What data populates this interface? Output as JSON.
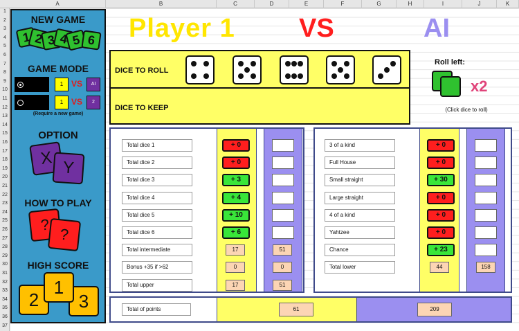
{
  "spreadsheet": {
    "columns": [
      "A",
      "B",
      "C",
      "D",
      "E",
      "F",
      "G",
      "H",
      "I",
      "J",
      "K"
    ],
    "rows": [
      "1",
      "2",
      "3",
      "4",
      "5",
      "6",
      "7",
      "8",
      "9",
      "10",
      "11",
      "12",
      "13",
      "14",
      "15",
      "16",
      "17",
      "18",
      "19",
      "20",
      "21",
      "22",
      "23",
      "24",
      "25",
      "26",
      "27",
      "28",
      "29",
      "30",
      "31",
      "32",
      "33",
      "34",
      "35",
      "36",
      "37"
    ]
  },
  "sidebar": {
    "new_game": {
      "title": "NEW GAME",
      "dice": [
        "1",
        "2",
        "3",
        "4",
        "5",
        "6"
      ]
    },
    "game_mode": {
      "title": "GAME MODE",
      "mode1": {
        "left": "1",
        "vs": "VS",
        "right": "AI"
      },
      "mode2": {
        "left": "1",
        "vs": "VS",
        "right": "2"
      },
      "note": "(Require a new game)"
    },
    "option": {
      "title": "OPTION",
      "dice": [
        "X",
        "Y"
      ]
    },
    "how_to_play": {
      "title": "HOW TO PLAY",
      "dice": [
        "?",
        "?"
      ]
    },
    "high_score": {
      "title": "HIGH SCORE",
      "dice": [
        "2",
        "1",
        "3"
      ]
    }
  },
  "header": {
    "player1": "Player 1",
    "vs": "VS",
    "player2": "AI"
  },
  "dice_panel": {
    "to_roll_label": "DICE TO ROLL",
    "to_keep_label": "DICE TO KEEP",
    "dice_to_roll": [
      4,
      5,
      6,
      5,
      3
    ]
  },
  "roll": {
    "label": "Roll left:",
    "count": "x2",
    "hint": "(Click dice to roll)"
  },
  "upper": {
    "rows": [
      {
        "label": "Total dice 1",
        "value": "+ 0",
        "color": "red"
      },
      {
        "label": "Total dice 2",
        "value": "+ 0",
        "color": "red"
      },
      {
        "label": "Total dice 3",
        "value": "+ 3",
        "color": "green"
      },
      {
        "label": "Total dice 4",
        "value": "+ 4",
        "color": "green"
      },
      {
        "label": "Total dice 5",
        "value": "+ 10",
        "color": "green"
      },
      {
        "label": "Total dice 6",
        "value": "+ 6",
        "color": "green"
      }
    ],
    "intermediate": {
      "label": "Total intermediate",
      "p1": "17",
      "ai": "51"
    },
    "bonus": {
      "label": "Bonus +35 if >62",
      "p1": "0",
      "ai": "0"
    },
    "total": {
      "label": "Total upper",
      "p1": "17",
      "ai": "51"
    }
  },
  "lower": {
    "rows": [
      {
        "label": "3 of a kind",
        "value": "+ 0",
        "color": "red"
      },
      {
        "label": "Full House",
        "value": "+ 0",
        "color": "red"
      },
      {
        "label": "Small straight",
        "value": "+ 30",
        "color": "green"
      },
      {
        "label": "Large straight",
        "value": "+ 0",
        "color": "red"
      },
      {
        "label": "4 of a kind",
        "value": "+ 0",
        "color": "red"
      },
      {
        "label": "Yahtzee",
        "value": "+ 0",
        "color": "red"
      },
      {
        "label": "Chance",
        "value": "+ 23",
        "color": "green"
      }
    ],
    "total": {
      "label": "Total lower",
      "p1": "44",
      "ai": "158"
    }
  },
  "points": {
    "label": "Total of points",
    "p1": "61",
    "ai": "209"
  },
  "colors": {
    "sidebar": "#3a9ac9",
    "player1": "#ffe600",
    "vs": "#ff1e1e",
    "ai": "#9b8ff0",
    "yellow_col": "#ffff66",
    "purple_col": "#9b8ff0",
    "chip_red": "#ff1e1e",
    "chip_green": "#39e639"
  }
}
